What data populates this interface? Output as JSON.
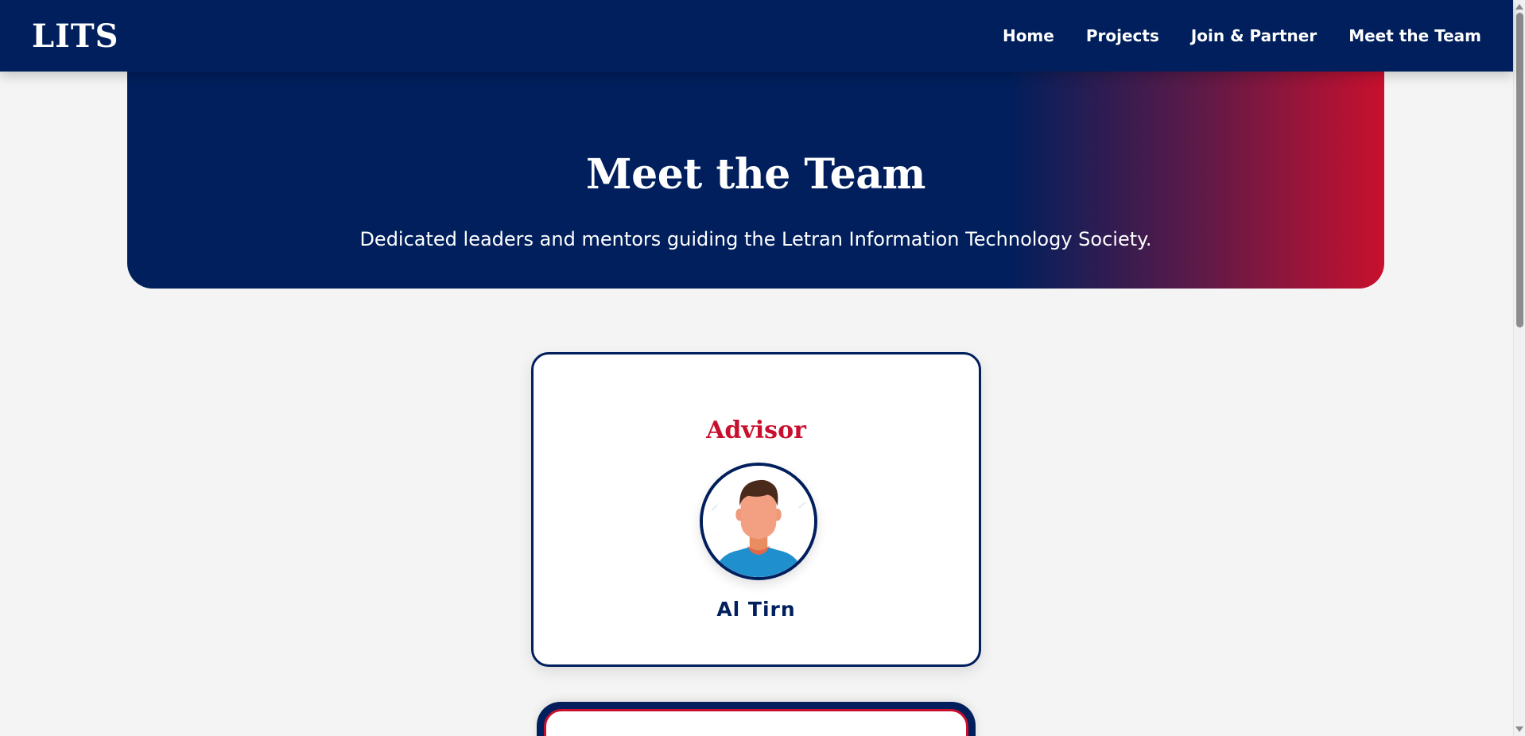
{
  "brand": {
    "logo": "LITS"
  },
  "nav": {
    "items": [
      {
        "label": "Home"
      },
      {
        "label": "Projects"
      },
      {
        "label": "Join & Partner"
      },
      {
        "label": "Meet the Team"
      }
    ]
  },
  "hero": {
    "title": "Meet the Team",
    "subtitle": "Dedicated leaders and mentors guiding the Letran Information Technology Society."
  },
  "team": {
    "advisor": {
      "role": "Advisor",
      "name": "Al Tirn",
      "avatar_icon": "person-avatar-icon"
    }
  },
  "colors": {
    "navy": "#001f5c",
    "crimson": "#c8102e",
    "background": "#f4f4f4"
  }
}
